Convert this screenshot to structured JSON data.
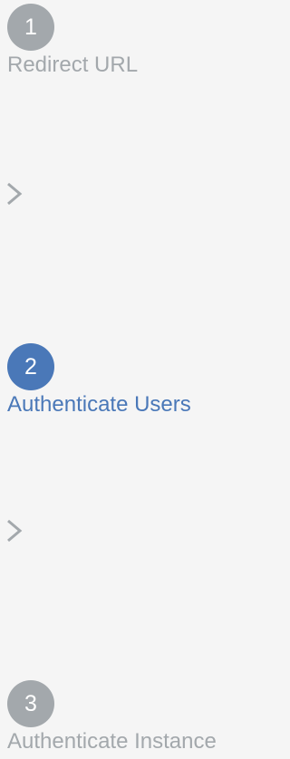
{
  "colors": {
    "background": "#f5f5f5",
    "inactive": "#a3a8ac",
    "active": "#4a78b8"
  },
  "steps": [
    {
      "number": "1",
      "label": "Redirect URL",
      "state": "inactive"
    },
    {
      "number": "2",
      "label": "Authenticate Users",
      "state": "active"
    },
    {
      "number": "3",
      "label": "Authenticate Instance",
      "state": "inactive"
    }
  ],
  "separator_icon": "chevron-right-icon"
}
